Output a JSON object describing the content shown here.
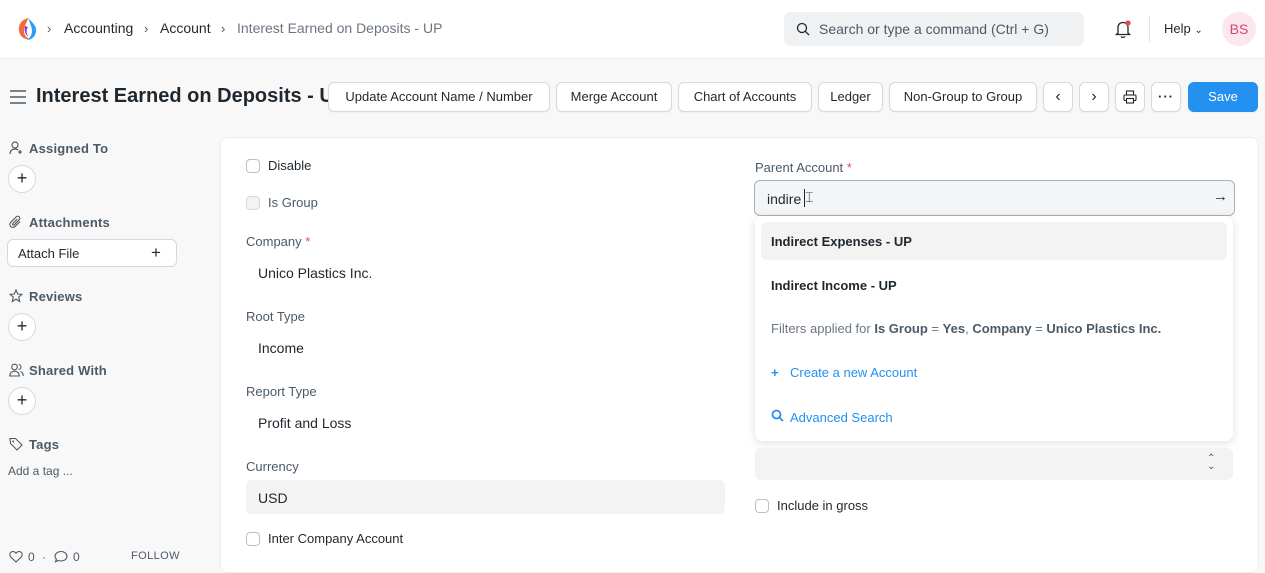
{
  "navbar": {
    "breadcrumbs": [
      "Accounting",
      "Account",
      "Interest Earned on Deposits - UP"
    ],
    "search_placeholder": "Search or type a command (Ctrl + G)",
    "help_label": "Help",
    "avatar_initials": "BS"
  },
  "page": {
    "title": "Interest Earned on Deposits - UP"
  },
  "actions": {
    "update_name": "Update Account Name / Number",
    "merge": "Merge Account",
    "chart": "Chart of Accounts",
    "ledger": "Ledger",
    "non_group": "Non-Group to Group",
    "save": "Save"
  },
  "sidebar": {
    "assigned_to": "Assigned To",
    "attachments": "Attachments",
    "attach_file": "Attach File",
    "reviews": "Reviews",
    "shared_with": "Shared With",
    "tags": "Tags",
    "add_tag": "Add a tag ...",
    "likes": "0",
    "comments": "0",
    "follow": "FOLLOW"
  },
  "form": {
    "disable_label": "Disable",
    "is_group_label": "Is Group",
    "company_label": "Company",
    "company_value": "Unico Plastics Inc.",
    "root_type_label": "Root Type",
    "root_type_value": "Income",
    "report_type_label": "Report Type",
    "report_type_value": "Profit and Loss",
    "currency_label": "Currency",
    "currency_value": "USD",
    "inter_company_label": "Inter Company Account",
    "parent_account_label": "Parent Account",
    "parent_account_value": "indire",
    "include_gross_label": "Include in gross"
  },
  "dropdown": {
    "items": [
      "Indirect Expenses - UP",
      "Indirect Income - UP"
    ],
    "filter_prefix": "Filters applied for",
    "filter_f1": "Is Group",
    "filter_v1": "Yes",
    "filter_f2": "Company",
    "filter_v2": "Unico Plastics Inc.",
    "create_new": "Create a new Account",
    "advanced_search": "Advanced Search"
  },
  "colors": {
    "primary": "#2490ef",
    "avatar_bg": "#fce7ef",
    "required": "#e24c4c"
  }
}
